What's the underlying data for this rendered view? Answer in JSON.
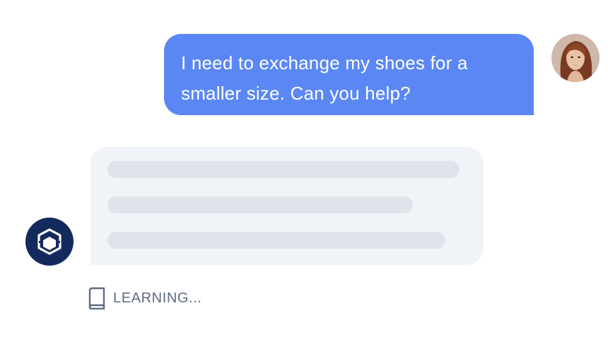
{
  "conversation": {
    "user_message": {
      "text": "I need to exchange my shoes for a smaller size. Can you help?",
      "bubble_color": "#5b87f4",
      "avatar_icon": "user-photo-avatar"
    },
    "assistant_message": {
      "state": "loading-skeleton",
      "skeleton_lines": 3,
      "bubble_color": "#f0f3f8",
      "skeleton_color": "#dfe3ea",
      "avatar_icon": "bot-logo-icon",
      "avatar_color": "#142a5c"
    },
    "status": {
      "icon": "book-icon",
      "label": "LEARNING..."
    }
  }
}
